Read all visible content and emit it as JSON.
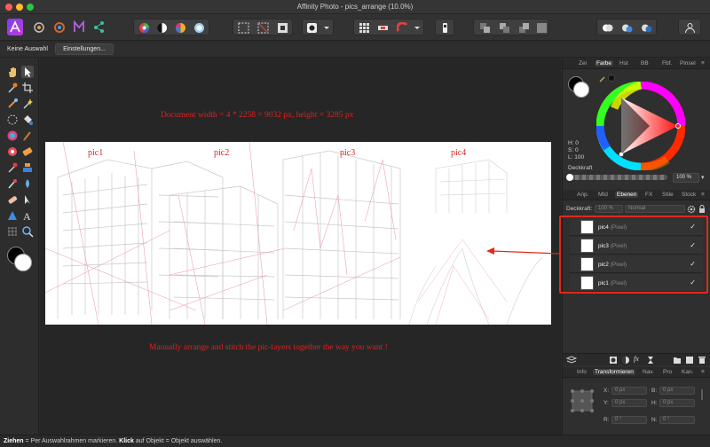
{
  "app": {
    "window_title": "Affinity Photo - pics_arrange (10.0%)"
  },
  "colors": {
    "traffic_close": "#ff5f57",
    "traffic_min": "#febc2e",
    "traffic_max": "#28c840",
    "annotation": "#e02020",
    "highlight_box": "#e02a1a"
  },
  "context_bar": {
    "selection_label": "Keine Auswahl",
    "settings_button": "Einstellungen..."
  },
  "toolbar": {
    "icons": [
      "persona-photo-icon",
      "persona-liquify-icon",
      "persona-develop-icon",
      "persona-tone-mapping-icon",
      "persona-export-icon",
      "color-wheel-icon",
      "contrast-icon",
      "hsl-icon",
      "white-balance-icon",
      "marquee-icon",
      "deselect-icon",
      "invert-selection-icon",
      "quick-mask-icon",
      "mask-dropdown-icon",
      "grid-icon",
      "snapping-icon",
      "magnet-icon",
      "align-icon",
      "arrange-front-icon",
      "arrange-back-icon",
      "boolean-icon",
      "assistant-icon",
      "user-icon"
    ]
  },
  "canvas": {
    "header_annotation": "Document  width = 4 * 2258 = 9032 px, height = 3285 px",
    "footer_annotation": "Manually arrange and stitch the pic-layers together the way you want !",
    "pic_labels": [
      "pic1",
      "pic2",
      "pic3",
      "pic4"
    ]
  },
  "panel": {
    "top_tabs": [
      "Zei",
      "Farbe",
      "Hst",
      "BB",
      "Fbf.",
      "Pinsel"
    ],
    "active_top_tab": "Farbe",
    "hsl": {
      "h": "H: 0",
      "s": "S: 0",
      "l": "L: 100"
    },
    "opacity_label": "Deckkraft",
    "opacity_value": "100 %",
    "mid_tabs": [
      "Anp.",
      "Mtd",
      "Ebenen",
      "FX",
      "Stile",
      "Stock"
    ],
    "active_mid_tab": "Ebenen",
    "layer_opacity_label": "Deckkraft:",
    "layer_opacity_value": "100 %",
    "blend_mode": "Normal",
    "layers": [
      {
        "name": "pic4",
        "type": "(Pixel)"
      },
      {
        "name": "pic3",
        "type": "(Pixel)"
      },
      {
        "name": "pic2",
        "type": "(Pixel)"
      },
      {
        "name": "pic1",
        "type": "(Pixel)"
      }
    ],
    "bottom_tabs": [
      "Info",
      "Transformieren",
      "Nav.",
      "Pro",
      "Kan."
    ],
    "active_bottom_tab": "Transformieren",
    "transform": {
      "x_label": "X:",
      "x_value": "0 px",
      "y_label": "Y:",
      "y_value": "0 px",
      "b_label": "B:",
      "b_value": "0 px",
      "h_label": "H:",
      "h_value": "0 px",
      "r_label": "R:",
      "r_value": "0 °",
      "n_label": "N:",
      "n_value": "0 °"
    }
  },
  "status": {
    "drag_bold": "Ziehen",
    "drag_text": " = Per Auswahlrahmen markieren. ",
    "click_bold": "Klick",
    "click_text": " auf Objekt = Objekt auswählen."
  }
}
